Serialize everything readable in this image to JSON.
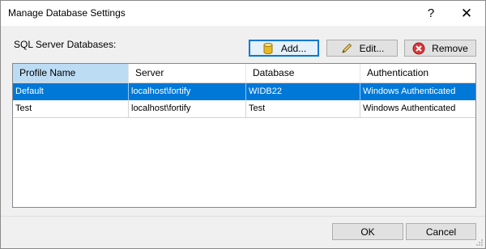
{
  "window": {
    "title": "Manage Database Settings",
    "help_label": "?",
    "close_label": "✕"
  },
  "section_label": "SQL Server Databases:",
  "toolbar": {
    "add_label": "Add...",
    "edit_label": "Edit...",
    "remove_label": "Remove"
  },
  "grid": {
    "columns": [
      "Profile Name",
      "Server",
      "Database",
      "Authentication"
    ],
    "rows": [
      [
        "Default",
        "localhost\\fortify",
        "WIDB22",
        "Windows Authenticated"
      ],
      [
        "Test",
        "localhost\\fortify",
        "Test",
        "Windows Authenticated"
      ]
    ],
    "selected_row": 0
  },
  "footer": {
    "ok_label": "OK",
    "cancel_label": "Cancel"
  },
  "colors": {
    "selection": "#0078d7",
    "header_selected": "#bcdcf4",
    "remove_icon": "#d9383a",
    "add_icon": "#e8b923"
  },
  "icons": {
    "add": "database-cylinder-icon",
    "edit": "pencil-icon",
    "remove": "remove-x-circle-icon"
  }
}
